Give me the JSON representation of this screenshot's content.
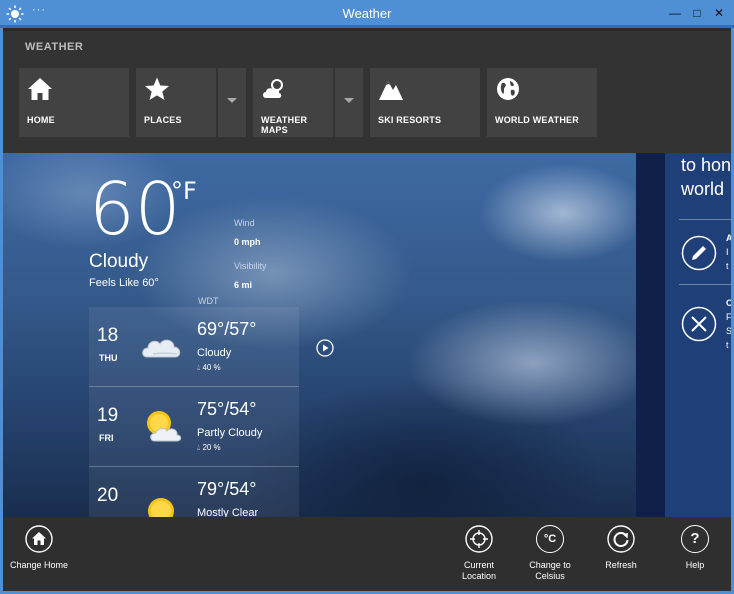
{
  "window": {
    "title": "Weather",
    "menu_dots": "···"
  },
  "nav": {
    "title": "WEATHER",
    "tiles": [
      {
        "label": "HOME",
        "icon": "home-icon"
      },
      {
        "label": "PLACES",
        "icon": "star-icon"
      },
      {
        "label": "WEATHER MAPS",
        "icon": "cloud-sun-icon"
      },
      {
        "label": "SKI RESORTS",
        "icon": "mountain-icon"
      },
      {
        "label": "WORLD WEATHER",
        "icon": "globe-icon"
      }
    ]
  },
  "current": {
    "temp": "60",
    "unit": "°F",
    "condition": "Cloudy",
    "feels_like": "Feels Like 60°",
    "wind_label": "Wind",
    "wind_value": "0 mph",
    "visibility_label": "Visibility",
    "visibility_value": "6 mi",
    "provider": "WDT"
  },
  "forecast": [
    {
      "day": "18",
      "weekday": "THU",
      "hilo": "69°/57°",
      "condition": "Cloudy",
      "precip": "40 %",
      "icon": "cloudy-icon"
    },
    {
      "day": "19",
      "weekday": "FRI",
      "hilo": "75°/54°",
      "condition": "Partly Cloudy",
      "precip": "20 %",
      "icon": "partly-cloudy-icon"
    },
    {
      "day": "20",
      "weekday": "",
      "hilo": "79°/54°",
      "condition": "Mostly Clear",
      "precip": "",
      "icon": "sunny-icon"
    }
  ],
  "side": {
    "line1": "to hon",
    "line2": "world",
    "frag1": [
      "A",
      "I",
      "t"
    ],
    "frag2": [
      "C",
      "F",
      "S",
      "t"
    ]
  },
  "appbar": {
    "change_home": "Change Home",
    "current_location_1": "Current",
    "current_location_2": "Location",
    "celsius_1": "Change to",
    "celsius_2": "Celsius",
    "celsius_glyph": "°C",
    "refresh": "Refresh",
    "help": "Help",
    "help_glyph": "?"
  }
}
